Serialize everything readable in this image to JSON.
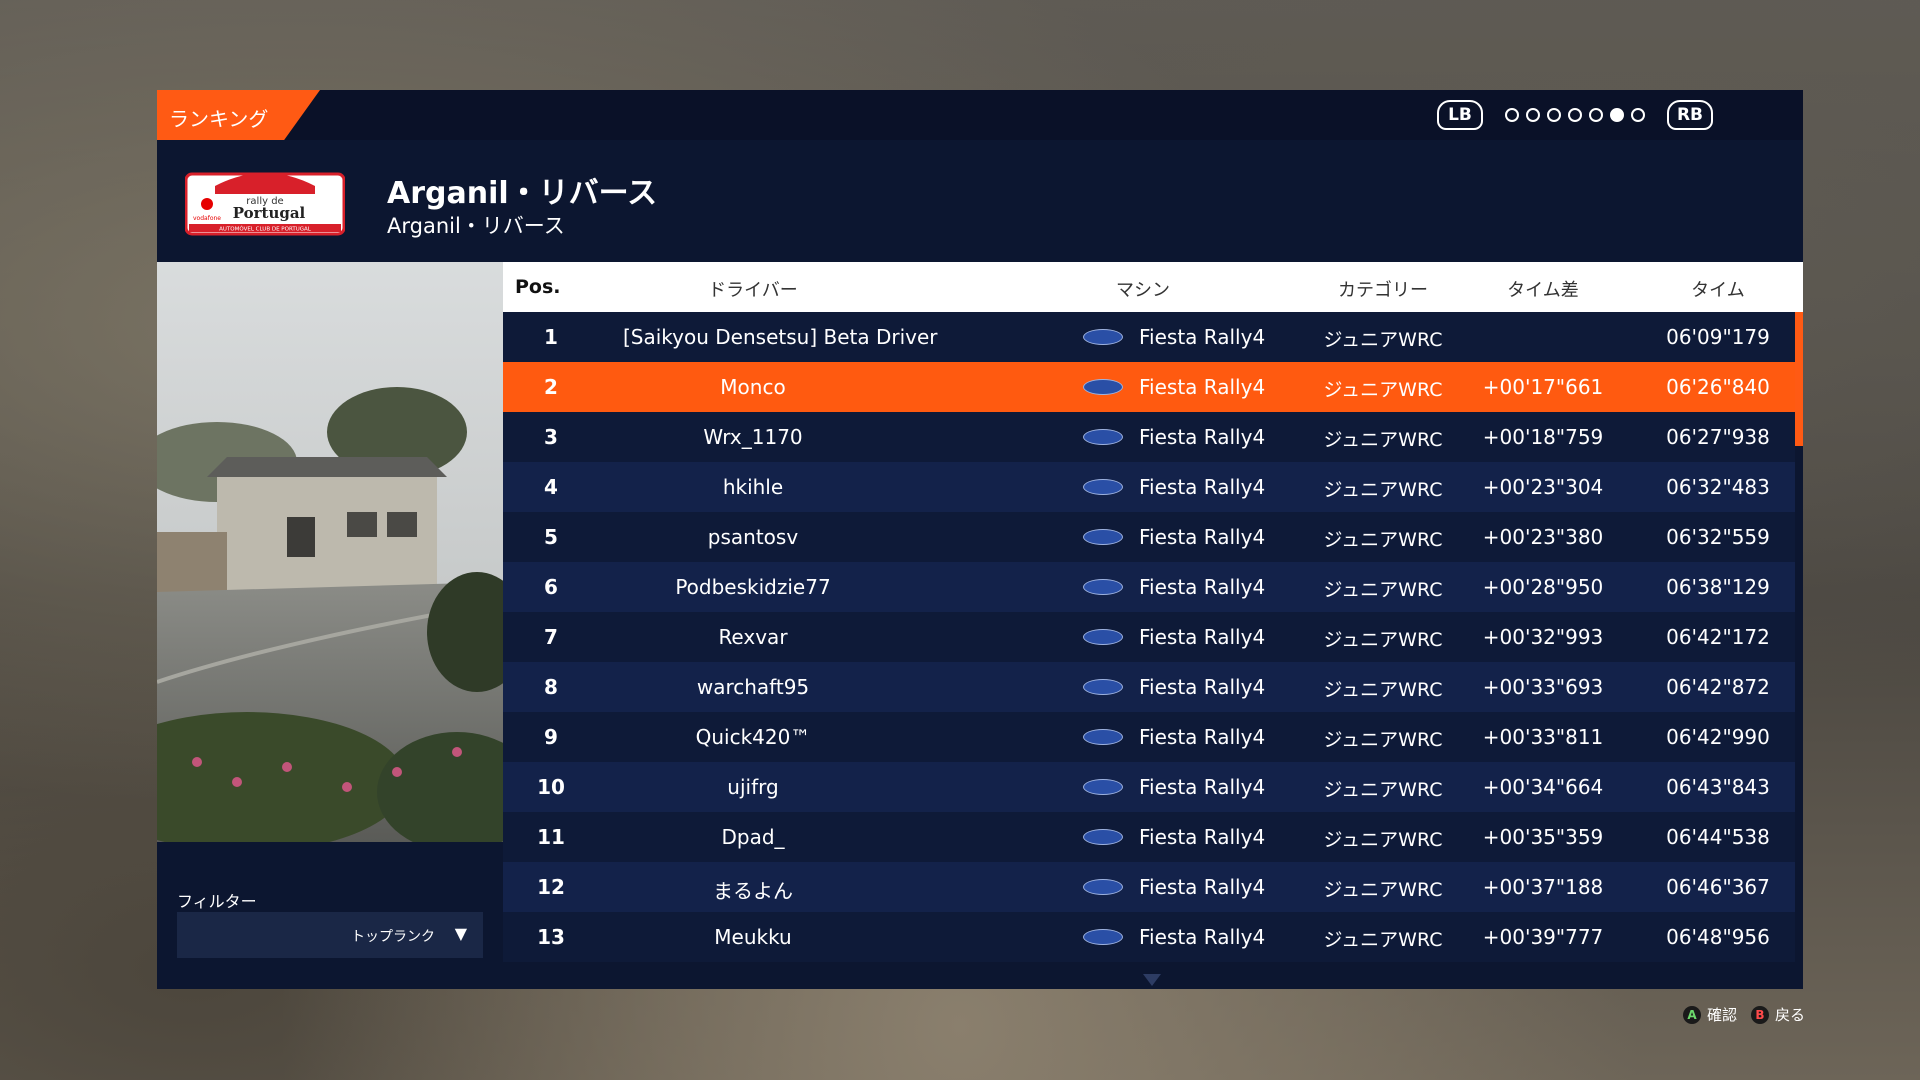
{
  "tab": {
    "label": "ランキング"
  },
  "pager": {
    "lb": "LB",
    "rb": "RB",
    "pages": 7,
    "active_page": 6
  },
  "stage": {
    "title": "Arganil・リバース",
    "subtitle": "Arganil・リバース"
  },
  "logo": {
    "line1": "rally de",
    "line2": "Portugal",
    "brand": "vodafone",
    "footer": "AUTOMÓVEL CLUB DE PORTUGAL"
  },
  "filter": {
    "label": "フィルター",
    "value": "トップランク"
  },
  "columns": {
    "pos": "Pos.",
    "driver": "ドライバー",
    "machine": "マシン",
    "category": "カテゴリー",
    "gap": "タイム差",
    "time": "タイム"
  },
  "rows": [
    {
      "pos": "1",
      "driver": "[Saikyou Densetsu] Beta Driver",
      "car": "Fiesta Rally4",
      "category": "ジュニアWRC",
      "gap": "",
      "time": "06'09\"179"
    },
    {
      "pos": "2",
      "driver": "Monco",
      "car": "Fiesta Rally4",
      "category": "ジュニアWRC",
      "gap": "+00'17\"661",
      "time": "06'26\"840"
    },
    {
      "pos": "3",
      "driver": "Wrx_1170",
      "car": "Fiesta Rally4",
      "category": "ジュニアWRC",
      "gap": "+00'18\"759",
      "time": "06'27\"938"
    },
    {
      "pos": "4",
      "driver": "hkihle",
      "car": "Fiesta Rally4",
      "category": "ジュニアWRC",
      "gap": "+00'23\"304",
      "time": "06'32\"483"
    },
    {
      "pos": "5",
      "driver": "psantosv",
      "car": "Fiesta Rally4",
      "category": "ジュニアWRC",
      "gap": "+00'23\"380",
      "time": "06'32\"559"
    },
    {
      "pos": "6",
      "driver": "Podbeskidzie77",
      "car": "Fiesta Rally4",
      "category": "ジュニアWRC",
      "gap": "+00'28\"950",
      "time": "06'38\"129"
    },
    {
      "pos": "7",
      "driver": "Rexvar",
      "car": "Fiesta Rally4",
      "category": "ジュニアWRC",
      "gap": "+00'32\"993",
      "time": "06'42\"172"
    },
    {
      "pos": "8",
      "driver": "warchaft95",
      "car": "Fiesta Rally4",
      "category": "ジュニアWRC",
      "gap": "+00'33\"693",
      "time": "06'42\"872"
    },
    {
      "pos": "9",
      "driver": "Quick420™",
      "car": "Fiesta Rally4",
      "category": "ジュニアWRC",
      "gap": "+00'33\"811",
      "time": "06'42\"990"
    },
    {
      "pos": "10",
      "driver": "ujifrg",
      "car": "Fiesta Rally4",
      "category": "ジュニアWRC",
      "gap": "+00'34\"664",
      "time": "06'43\"843"
    },
    {
      "pos": "11",
      "driver": "Dpad_",
      "car": "Fiesta Rally4",
      "category": "ジュニアWRC",
      "gap": "+00'35\"359",
      "time": "06'44\"538"
    },
    {
      "pos": "12",
      "driver": "まるよん",
      "car": "Fiesta Rally4",
      "category": "ジュニアWRC",
      "gap": "+00'37\"188",
      "time": "06'46\"367"
    },
    {
      "pos": "13",
      "driver": "Meukku",
      "car": "Fiesta Rally4",
      "category": "ジュニアWRC",
      "gap": "+00'39\"777",
      "time": "06'48\"956"
    }
  ],
  "selected_row": 1,
  "footer": {
    "confirm_key": "A",
    "confirm": "確認",
    "back_key": "B",
    "back": "戻る"
  },
  "colors": {
    "accent": "#ff5a14",
    "panel": "#0c1630",
    "row_dark": "#0e1a38",
    "row_light": "#13224a"
  }
}
